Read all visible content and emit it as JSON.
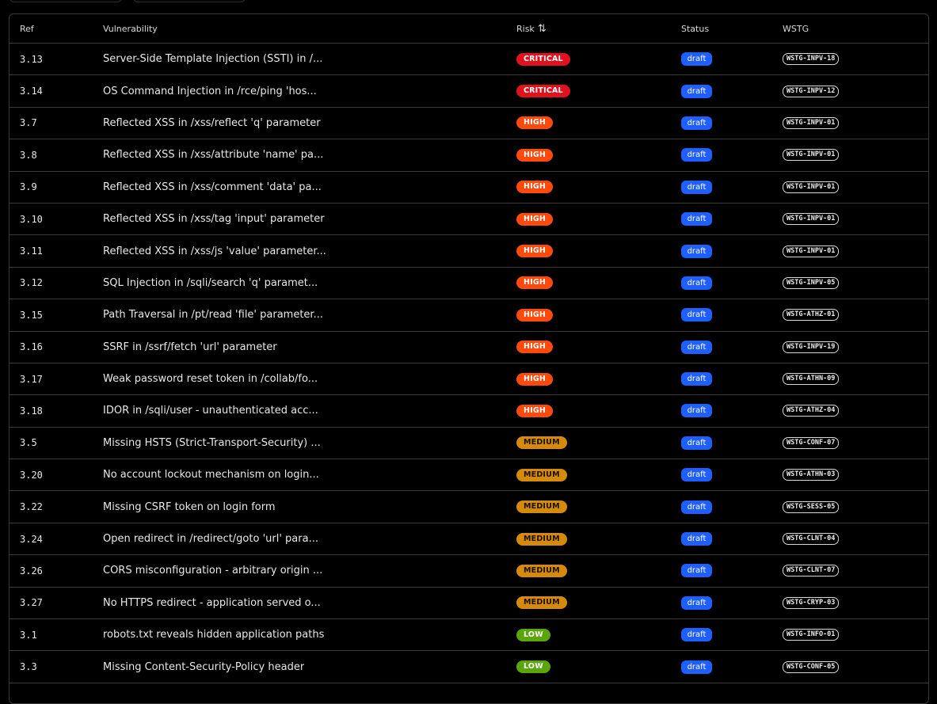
{
  "header": {
    "ref": "Ref",
    "vulnerability": "Vulnerability",
    "risk": "Risk",
    "status": "Status",
    "wstg": "WSTG"
  },
  "rows": [
    {
      "ref": "3.13",
      "vulnerability": "Server-Side Template Injection (SSTI) in /...",
      "risk": "CRITICAL",
      "status": "draft",
      "wstg": "WSTG-INPV-18"
    },
    {
      "ref": "3.14",
      "vulnerability": "OS Command Injection in /rce/ping 'hos...",
      "risk": "CRITICAL",
      "status": "draft",
      "wstg": "WSTG-INPV-12"
    },
    {
      "ref": "3.7",
      "vulnerability": "Reflected XSS in /xss/reflect 'q' parameter",
      "risk": "HIGH",
      "status": "draft",
      "wstg": "WSTG-INPV-01"
    },
    {
      "ref": "3.8",
      "vulnerability": "Reflected XSS in /xss/attribute 'name' pa...",
      "risk": "HIGH",
      "status": "draft",
      "wstg": "WSTG-INPV-01"
    },
    {
      "ref": "3.9",
      "vulnerability": "Reflected XSS in /xss/comment 'data' pa...",
      "risk": "HIGH",
      "status": "draft",
      "wstg": "WSTG-INPV-01"
    },
    {
      "ref": "3.10",
      "vulnerability": "Reflected XSS in /xss/tag 'input' parameter",
      "risk": "HIGH",
      "status": "draft",
      "wstg": "WSTG-INPV-01"
    },
    {
      "ref": "3.11",
      "vulnerability": "Reflected XSS in /xss/js 'value' parameter...",
      "risk": "HIGH",
      "status": "draft",
      "wstg": "WSTG-INPV-01"
    },
    {
      "ref": "3.12",
      "vulnerability": "SQL Injection in /sqli/search 'q' paramet...",
      "risk": "HIGH",
      "status": "draft",
      "wstg": "WSTG-INPV-05"
    },
    {
      "ref": "3.15",
      "vulnerability": "Path Traversal in /pt/read 'file' parameter...",
      "risk": "HIGH",
      "status": "draft",
      "wstg": "WSTG-ATHZ-01"
    },
    {
      "ref": "3.16",
      "vulnerability": "SSRF in /ssrf/fetch 'url' parameter",
      "risk": "HIGH",
      "status": "draft",
      "wstg": "WSTG-INPV-19"
    },
    {
      "ref": "3.17",
      "vulnerability": "Weak password reset token in /collab/fo...",
      "risk": "HIGH",
      "status": "draft",
      "wstg": "WSTG-ATHN-09"
    },
    {
      "ref": "3.18",
      "vulnerability": "IDOR in /sqli/user - unauthenticated acc...",
      "risk": "HIGH",
      "status": "draft",
      "wstg": "WSTG-ATHZ-04"
    },
    {
      "ref": "3.5",
      "vulnerability": "Missing HSTS (Strict-Transport-Security) ...",
      "risk": "MEDIUM",
      "status": "draft",
      "wstg": "WSTG-CONF-07"
    },
    {
      "ref": "3.20",
      "vulnerability": "No account lockout mechanism on login...",
      "risk": "MEDIUM",
      "status": "draft",
      "wstg": "WSTG-ATHN-03"
    },
    {
      "ref": "3.22",
      "vulnerability": "Missing CSRF token on login form",
      "risk": "MEDIUM",
      "status": "draft",
      "wstg": "WSTG-SESS-05"
    },
    {
      "ref": "3.24",
      "vulnerability": "Open redirect in /redirect/goto 'url' para...",
      "risk": "MEDIUM",
      "status": "draft",
      "wstg": "WSTG-CLNT-04"
    },
    {
      "ref": "3.26",
      "vulnerability": "CORS misconfiguration - arbitrary origin ...",
      "risk": "MEDIUM",
      "status": "draft",
      "wstg": "WSTG-CLNT-07"
    },
    {
      "ref": "3.27",
      "vulnerability": "No HTTPS redirect - application served o...",
      "risk": "MEDIUM",
      "status": "draft",
      "wstg": "WSTG-CRYP-03"
    },
    {
      "ref": "3.1",
      "vulnerability": "robots.txt reveals hidden application paths",
      "risk": "LOW",
      "status": "draft",
      "wstg": "WSTG-INFO-01"
    },
    {
      "ref": "3.3",
      "vulnerability": "Missing Content-Security-Policy header",
      "risk": "LOW",
      "status": "draft",
      "wstg": "WSTG-CONF-05"
    }
  ],
  "colors": {
    "critical": "#e0121d",
    "high": "#ff4a0d",
    "medium": "#d58a0a",
    "low": "#5aa60a",
    "status_draft": "#1f5fff"
  },
  "icons": {
    "risk_sort": "sort-arrows-icon"
  }
}
